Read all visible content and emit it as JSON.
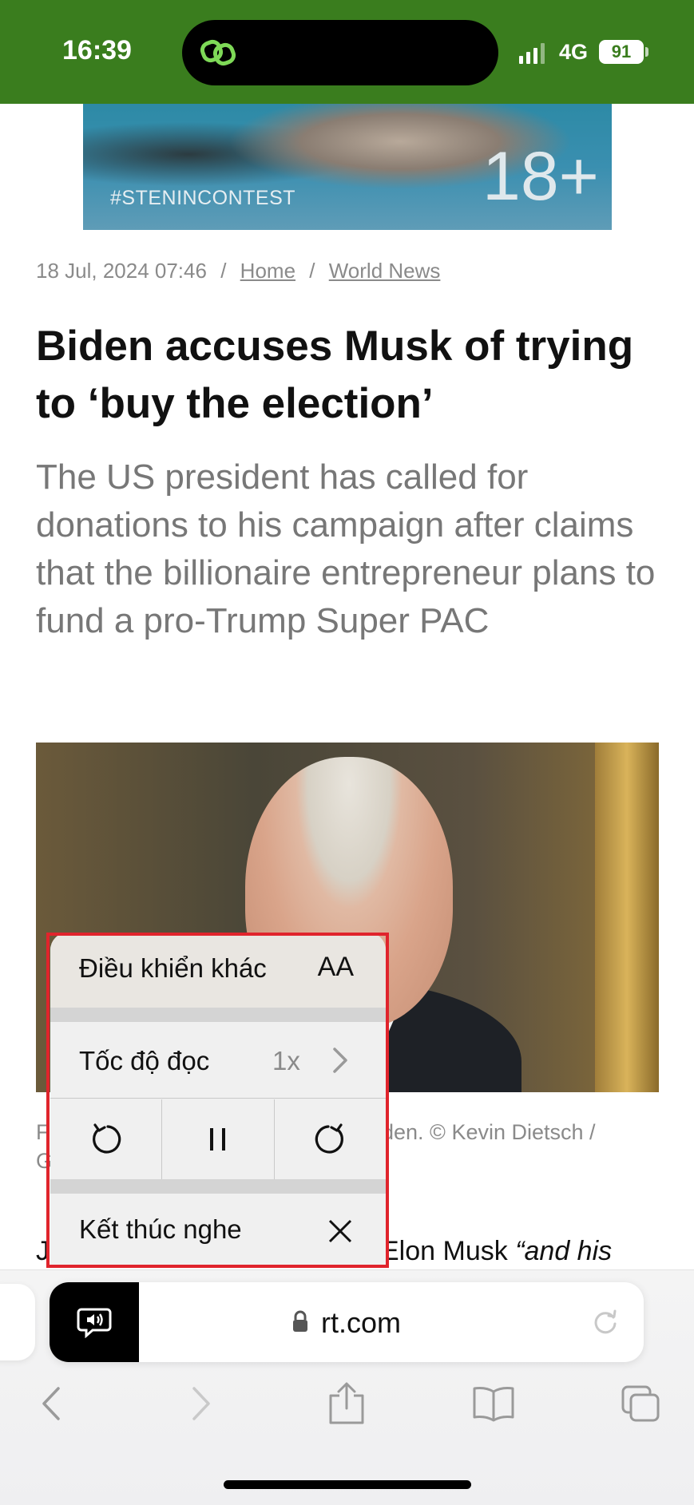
{
  "status_bar": {
    "time": "16:39",
    "network": "4G",
    "battery": "91"
  },
  "banner": {
    "tag": "#STENINCONTEST",
    "age_rating": "18+"
  },
  "breadcrumb": {
    "date": "18 Jul, 2024 07:46",
    "home": "Home",
    "section": "World News",
    "separator": "/"
  },
  "article": {
    "headline": "Biden accuses Musk of trying to ‘buy the election’",
    "summary": "The US president has called for donations to his campaign after claims that the billionaire entrepreneur plans to fund a pro-Trump Super PAC",
    "caption_left_line1": "F",
    "caption_left_line2": "G",
    "caption_right": "den. ©  Kevin Dietsch /",
    "body_peek_left": "J",
    "body_peek_mid": "Elon Musk ",
    "body_peek_italic": "“and his"
  },
  "speak_controls": {
    "more_controls_label": "Điều khiển khác",
    "text_size_label": "AA",
    "reading_speed_label": "Tốc độ đọc",
    "reading_speed_value": "1x",
    "end_listening_label": "Kết thúc nghe"
  },
  "url_bar": {
    "host": "rt.com"
  },
  "colors": {
    "status_bar": "#3a7d1e",
    "highlight_outline": "#e0242c"
  }
}
